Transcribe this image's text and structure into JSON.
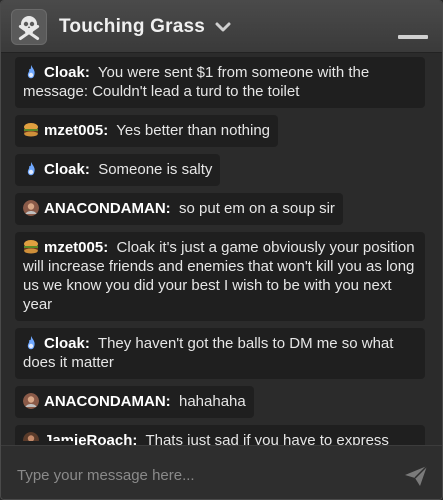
{
  "window": {
    "title": "Touching Grass"
  },
  "input": {
    "placeholder": "Type your message here..."
  },
  "messages": [
    {
      "user": "Cloak:",
      "avatar": "blue-flame-icon",
      "text": "You were sent $1 from someone with the message: Couldn't lead a turd to the toilet"
    },
    {
      "user": "mzet005:",
      "avatar": "burger-icon",
      "text": "Yes better than nothing"
    },
    {
      "user": "Cloak:",
      "avatar": "blue-flame-icon",
      "text": "Someone is salty"
    },
    {
      "user": "ANACONDAMAN:",
      "avatar": "user-photo-avatar",
      "text": "so put em on a soup sir"
    },
    {
      "user": "mzet005:",
      "avatar": "burger-icon",
      "text": "Cloak it's just a game obviously your position will increase friends and enemies that won't kill you as long us we know you did your best I wish to be with you next year"
    },
    {
      "user": "Cloak:",
      "avatar": "blue-flame-icon",
      "text": "They haven't got the balls to DM me so what does it matter"
    },
    {
      "user": "ANACONDAMAN:",
      "avatar": "user-photo-avatar",
      "text": "hahahaha"
    },
    {
      "user": "JamieRoach:",
      "avatar": "user-photo-avatar-2",
      "text": "Thats just sad if you have to express your feelings like that :-/"
    }
  ]
}
